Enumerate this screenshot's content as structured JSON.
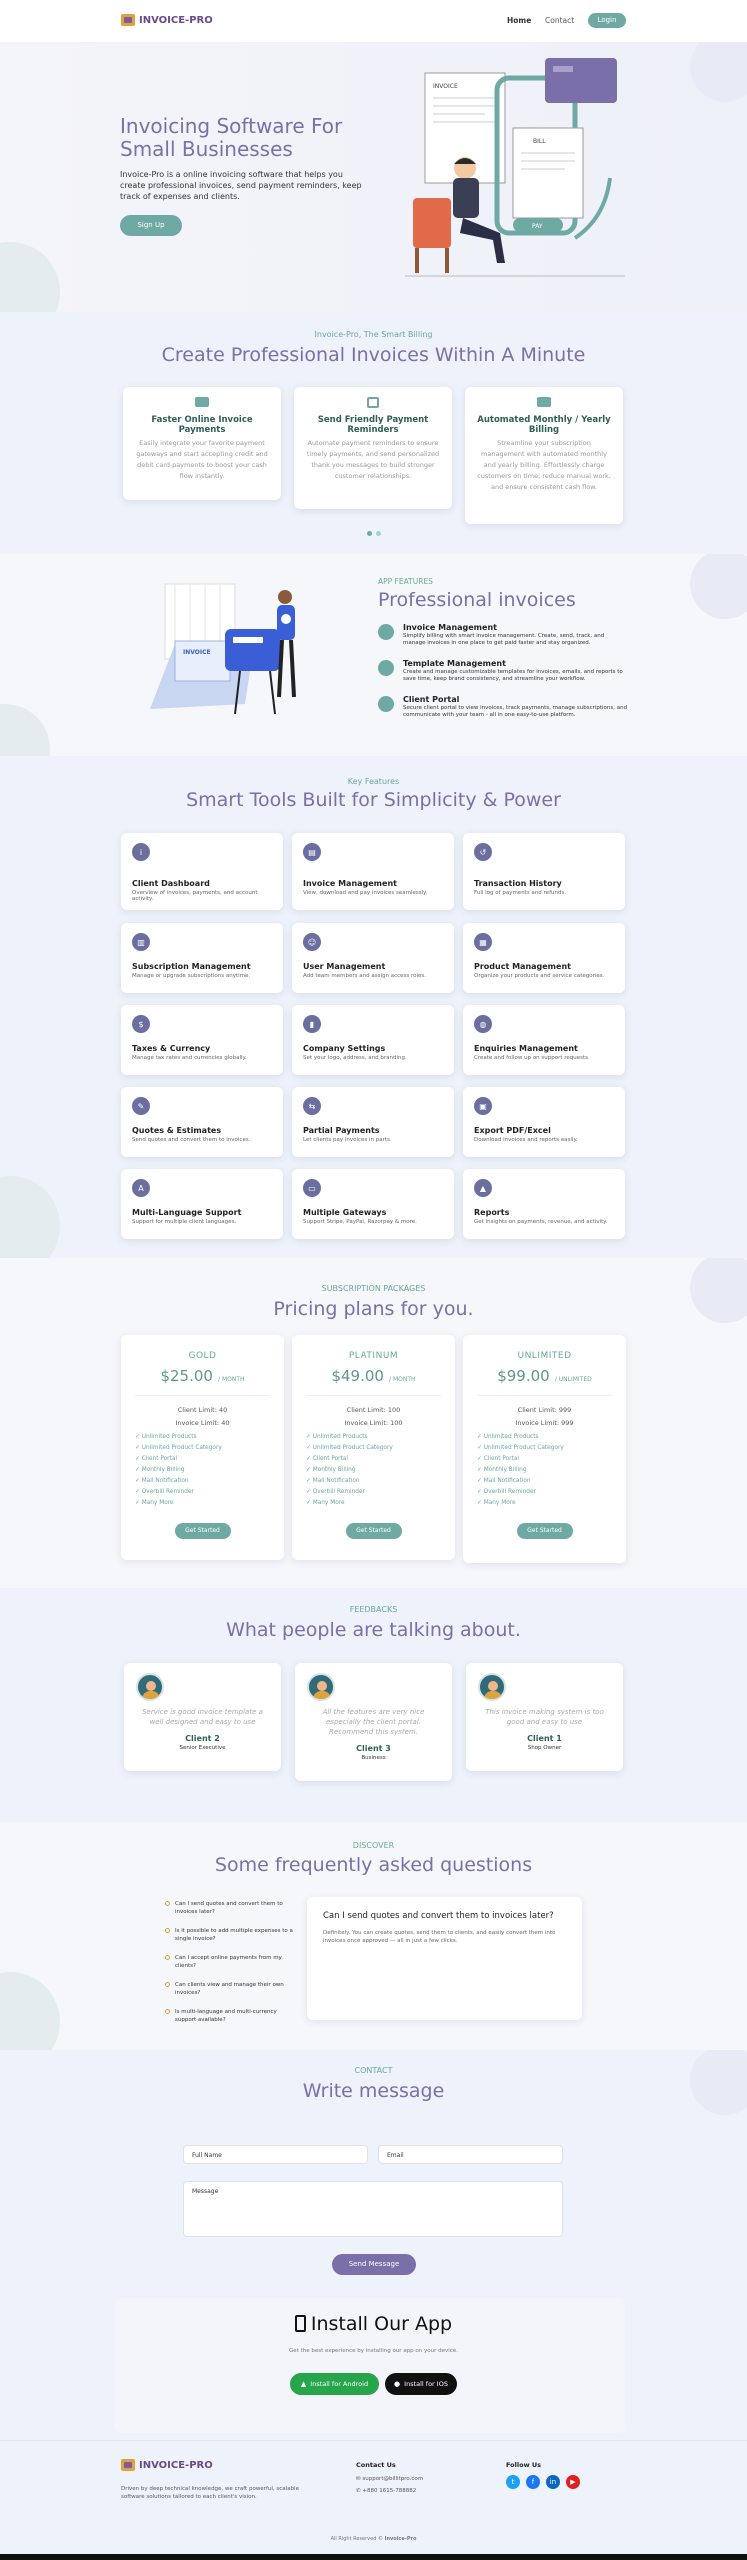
{
  "brand": {
    "name": "INVOICE-PRO"
  },
  "nav": {
    "home": "Home",
    "contact": "Contact",
    "login": "Login"
  },
  "hero": {
    "title_line1": "Invoicing Software For",
    "title_line2": "Small Businesses",
    "desc": "Invoice-Pro is a online invoicing software that helps you create professional invoices, send payment reminders, keep track of expenses and clients.",
    "cta": "Sign Up",
    "illus": {
      "invoice": "INVOICE",
      "bill": "BILL",
      "pay": "PAY"
    }
  },
  "smart": {
    "kicker": "Invoice-Pro, The Smart Billing",
    "title": "Create Professional Invoices Within A Minute",
    "cards": [
      {
        "title": "Faster Online Invoice Payments",
        "text": "Easily integrate your favorite payment gateways and start accepting credit and debit card payments to boost your cash flow instantly."
      },
      {
        "title": "Send Friendly Payment Reminders",
        "text": "Automate payment reminders to ensure timely payments, and send personalized thank you messages to build stronger customer relationships."
      },
      {
        "title": "Automated Monthly / Yearly Billing",
        "text": "Streamline your subscription management with automated monthly and yearly billing. Effortlessly charge customers on time, reduce manual work, and ensure consistent cash flow."
      }
    ]
  },
  "app": {
    "kicker": "APP FEATURES",
    "title": "Professional invoices",
    "illus_label": "INVOICE",
    "items": [
      {
        "title": "Invoice Management",
        "text": "Simplify billing with smart invoice management. Create, send, track, and manage invoices in one place to get paid faster and stay organized."
      },
      {
        "title": "Template Management",
        "text": "Create and manage customizable templates for invoices, emails, and reports to save time, keep brand consistency, and streamline your workflow."
      },
      {
        "title": "Client Portal",
        "text": "Secure client portal to view invoices, track payments, manage subscriptions, and communicate with your team - all in one easy-to-use platform."
      }
    ]
  },
  "features": {
    "kicker": "Key Features",
    "title": "Smart Tools Built for Simplicity & Power",
    "items": [
      {
        "title": "Client Dashboard",
        "text": "Overview of invoices, payments, and account activity.",
        "icon": "info-icon"
      },
      {
        "title": "Invoice Management",
        "text": "View, download and pay invoices seamlessly.",
        "icon": "document-icon"
      },
      {
        "title": "Transaction History",
        "text": "Full log of payments and refunds.",
        "icon": "history-icon"
      },
      {
        "title": "Subscription Management",
        "text": "Manage or upgrade subscriptions anytime.",
        "icon": "receipt-icon"
      },
      {
        "title": "User Management",
        "text": "Add team members and assign access roles.",
        "icon": "users-icon"
      },
      {
        "title": "Product Management",
        "text": "Organize your products and service categories.",
        "icon": "boxes-icon"
      },
      {
        "title": "Taxes & Currency",
        "text": "Manage tax rates and currencies globally.",
        "icon": "money-icon"
      },
      {
        "title": "Company Settings",
        "text": "Set your logo, address, and branding.",
        "icon": "bookmark-icon"
      },
      {
        "title": "Enquiries Management",
        "text": "Create and follow up on support requests.",
        "icon": "globe-icon"
      },
      {
        "title": "Quotes & Estimates",
        "text": "Send quotes and convert them to invoices.",
        "icon": "edit-icon"
      },
      {
        "title": "Partial Payments",
        "text": "Let clients pay invoices in parts.",
        "icon": "split-icon"
      },
      {
        "title": "Export PDF/Excel",
        "text": "Download invoices and reports easily.",
        "icon": "pdf-icon"
      },
      {
        "title": "Multi-Language Support",
        "text": "Support for multiple client languages.",
        "icon": "language-icon"
      },
      {
        "title": "Multiple Gateways",
        "text": "Support Stripe, PayPal, Razorpay & more.",
        "icon": "card-icon"
      },
      {
        "title": "Reports",
        "text": "Get insights on payments, revenue, and activity.",
        "icon": "chart-icon"
      }
    ]
  },
  "pricing": {
    "kicker": "SUBSCRIPTION PACKAGES",
    "title": "Pricing plans for you.",
    "plans": [
      {
        "name": "GOLD",
        "price": "$25.00",
        "period": "/ MONTH",
        "client_limit": "Client Limit: 40",
        "invoice_limit": "Invoice Limit: 40",
        "cta": "Get Started"
      },
      {
        "name": "PLATINUM",
        "price": "$49.00",
        "period": "/ MONTH",
        "client_limit": "Client Limit: 100",
        "invoice_limit": "Invoice Limit: 100",
        "cta": "Get Started"
      },
      {
        "name": "UNLIMITED",
        "price": "$99.00",
        "period": "/ UNLIMITED",
        "client_limit": "Client Limit: 999",
        "invoice_limit": "Invoice Limit: 999",
        "cta": "Get Started"
      }
    ],
    "features": [
      "Unlimited Products",
      "Unlimited Product Category",
      "Client Portal",
      "Monthly Billing",
      "Mail Notification",
      "Overbill Reminder",
      "Many More"
    ]
  },
  "testimonials": {
    "kicker": "FEEDBACKS",
    "title": "What people are talking about.",
    "items": [
      {
        "quote": "Service is good invoice template a well designed and easy to use",
        "name": "Client 2",
        "role": "Senior Executive"
      },
      {
        "quote": "All the features are very nice especially the client portal. Recommend this system.",
        "name": "Client 3",
        "role": "Business"
      },
      {
        "quote": "This invoice making system is too good and easy to use",
        "name": "Client 1",
        "role": "Shop Owner"
      }
    ]
  },
  "faq": {
    "kicker": "DISCOVER",
    "title": "Some frequently asked questions",
    "items": [
      "Can I send quotes and convert them to invoices later?",
      "Is it possible to add multiple expenses to a single invoice?",
      "Can I accept online payments from my clients?",
      "Can clients view and manage their own invoices?",
      "Is multi-language and multi-currency support available?"
    ],
    "active_q": "Can I send quotes and convert them to invoices later?",
    "active_a": "Definitely. You can create quotes, send them to clients, and easily convert them into invoices once approved — all in just a few clicks."
  },
  "contact": {
    "kicker": "CONTACT",
    "title": "Write message",
    "full_name": "Full Name",
    "email": "Email",
    "message": "Message",
    "send": "Send Message"
  },
  "install": {
    "title": "Install Our App",
    "sub": "Get the best experience by installing our app on your device.",
    "android": "Install for Android",
    "ios": "Install for IOS"
  },
  "footer": {
    "about": "Driven by deep technical knowledge, we craft powerful, scalable software solutions tailored to each client's vision.",
    "contact_title": "Contact Us",
    "email": "support@billitpro.com",
    "phone": "+880 1615-788882",
    "follow_title": "Follow Us",
    "copyright": "All Right Reserved",
    "copyright_brand": "Invoice-Pro"
  }
}
